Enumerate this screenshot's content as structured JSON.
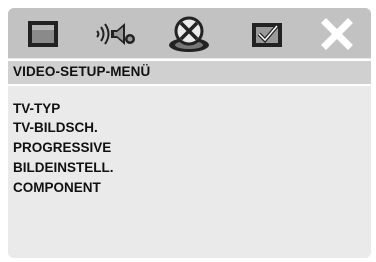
{
  "toolbar": {
    "tabs": [
      {
        "icon": "display-icon"
      },
      {
        "icon": "speaker-icon"
      },
      {
        "icon": "video-disc-icon",
        "selected": true
      },
      {
        "icon": "preference-check-icon"
      },
      {
        "icon": "close-icon"
      }
    ]
  },
  "header": {
    "title": "VIDEO-SETUP-MENÜ"
  },
  "menu": {
    "items": [
      {
        "label": "TV-TYP"
      },
      {
        "label": "TV-BILDSCH."
      },
      {
        "label": "PROGRESSIVE"
      },
      {
        "label": "BILDEINSTELL."
      },
      {
        "label": "COMPONENT"
      }
    ]
  },
  "colors": {
    "toolbar_bg": "#c2c2c2",
    "header_bg": "#d0d0d0",
    "menu_bg": "#eaeaea",
    "text": "#111111"
  }
}
